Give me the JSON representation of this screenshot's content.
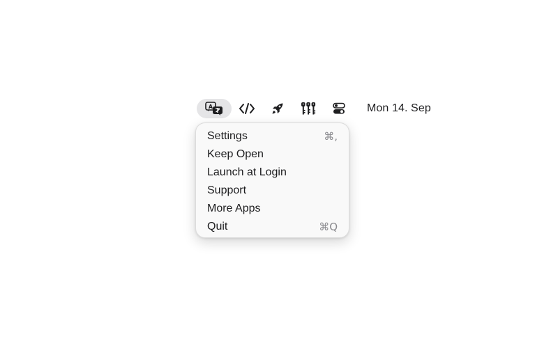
{
  "menubar": {
    "icons": [
      {
        "name": "translate-icon",
        "active": true
      },
      {
        "name": "code-icon",
        "active": false
      },
      {
        "name": "rocket-icon",
        "active": false
      },
      {
        "name": "keys-icon",
        "active": false
      },
      {
        "name": "toggles-icon",
        "active": false
      }
    ],
    "clock": "Mon 14. Sep"
  },
  "menu": {
    "items": [
      {
        "label": "Settings",
        "shortcut": "⌘,"
      },
      {
        "label": "Keep Open",
        "shortcut": ""
      },
      {
        "label": "Launch at Login",
        "shortcut": ""
      },
      {
        "label": "Support",
        "shortcut": ""
      },
      {
        "label": "More Apps",
        "shortcut": ""
      },
      {
        "label": "Quit",
        "shortcut": "⌘Q"
      }
    ]
  },
  "colors": {
    "active_highlight": "#e5e5e7",
    "menu_background": "#f9f9f9",
    "shortcut_text": "#8a8a8e"
  }
}
